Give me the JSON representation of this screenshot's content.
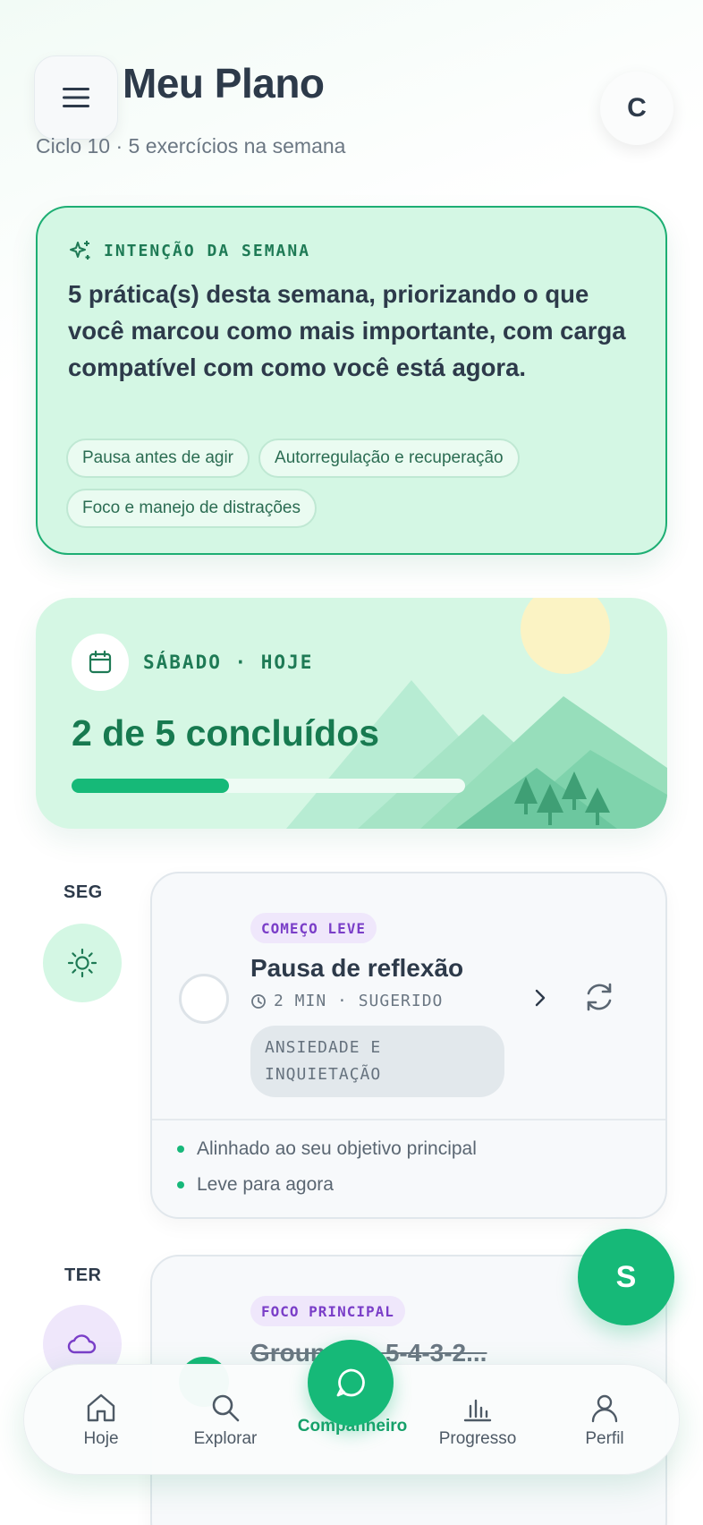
{
  "header": {
    "title": "Meu Plano",
    "subtitle": "Ciclo 10 · 5 exercícios na semana",
    "avatar_initial": "C"
  },
  "intention": {
    "label": "INTENÇÃO DA SEMANA",
    "text": "5 prática(s) desta semana, priorizando o que você marcou como mais importante, com carga compatível com como você está agora.",
    "chips": [
      "Pausa antes de agir",
      "Autorregulação e recuperação",
      "Foco e manejo de distrações"
    ]
  },
  "today": {
    "label": "SÁBADO · HOJE",
    "count_text": "2 de 5 concluídos",
    "completed": 2,
    "total": 5
  },
  "days": [
    {
      "day": "SEG",
      "icon": "sun-icon",
      "tag": "COMEÇO LEVE",
      "title": "Pausa de reflexão",
      "meta": "2 MIN · SUGERIDO",
      "category": "ANSIEDADE E INQUIETAÇÃO",
      "reasons": [
        "Alinhado ao seu objetivo principal",
        "Leve para agora"
      ]
    },
    {
      "day": "TER",
      "icon": "cloud-icon",
      "tag": "FOCO PRINCIPAL",
      "title": "Grounding 5-4-3-2..."
    }
  ],
  "fab_initial": "S",
  "nav": {
    "items": [
      {
        "label": "Hoje",
        "icon": "home-icon"
      },
      {
        "label": "Explorar",
        "icon": "search-icon"
      },
      {
        "label": "Companheiro",
        "icon": "chat-icon"
      },
      {
        "label": "Progresso",
        "icon": "chart-icon"
      },
      {
        "label": "Perfil",
        "icon": "user-icon"
      }
    ],
    "active": "Companheiro"
  },
  "colors": {
    "accent": "#16b978",
    "intent_bg": "#d4f7e4",
    "tag_purple": "#7a3ec8"
  }
}
